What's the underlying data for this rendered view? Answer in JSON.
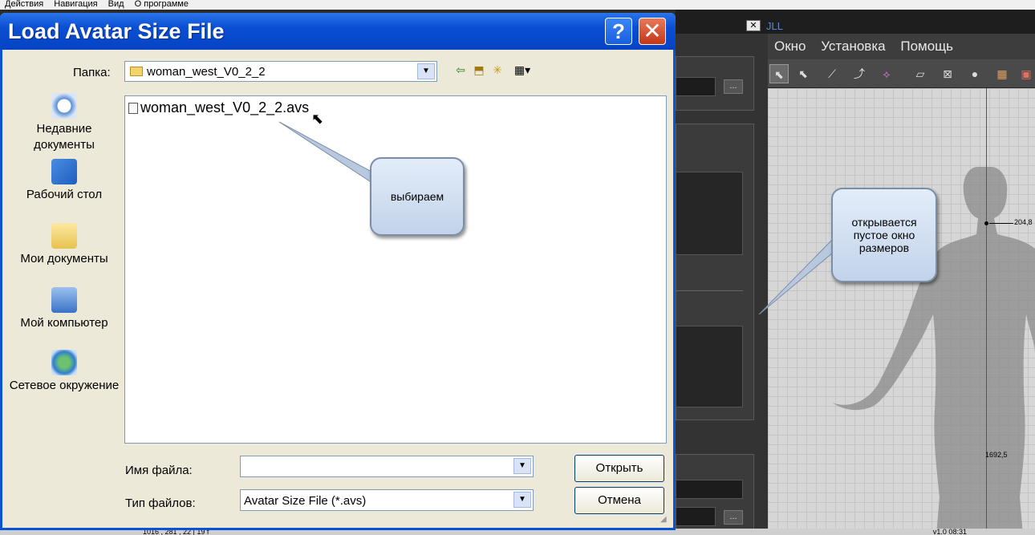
{
  "background_app": {
    "menubar": [
      "Действия",
      "Навигация",
      "Вид",
      "О программе"
    ],
    "title_fragment": "JLL",
    "close_glyph": "✕",
    "menu": [
      "Окно",
      "Установка",
      "Помощь"
    ],
    "dots_label": "...",
    "measure_top": "204,8",
    "measure_bottom": "1692,5",
    "status_left": "1016 , 281 , 22 | 19 f",
    "status_right": "v1.0   08:31"
  },
  "dialog": {
    "title": "Load Avatar Size File",
    "help_glyph": "?",
    "close_glyph": "✕",
    "folder_label": "Папка:",
    "folder_value": "woman_west_V0_2_2",
    "places": [
      {
        "label": "Недавние документы",
        "icon": "recent-documents-icon"
      },
      {
        "label": "Рабочий стол",
        "icon": "desktop-icon"
      },
      {
        "label": "Мои документы",
        "icon": "my-documents-icon"
      },
      {
        "label": "Мой компьютер",
        "icon": "my-computer-icon"
      },
      {
        "label": "Сетевое окружение",
        "icon": "network-icon"
      }
    ],
    "files": [
      "woman_west_V0_2_2.avs"
    ],
    "filename_label": "Имя файла:",
    "filename_value": "",
    "filetype_label": "Тип файлов:",
    "filetype_value": "Avatar Size File (*.avs)",
    "open_button": "Открыть",
    "cancel_button": "Отмена"
  },
  "callouts": {
    "select": "выбираем",
    "empty_window": "открывается пустое окно размеров"
  },
  "colors": {
    "titlebar": "#0a4fd3",
    "dialog_body": "#ece9d8",
    "callout_fill": "#d3e0f2"
  }
}
